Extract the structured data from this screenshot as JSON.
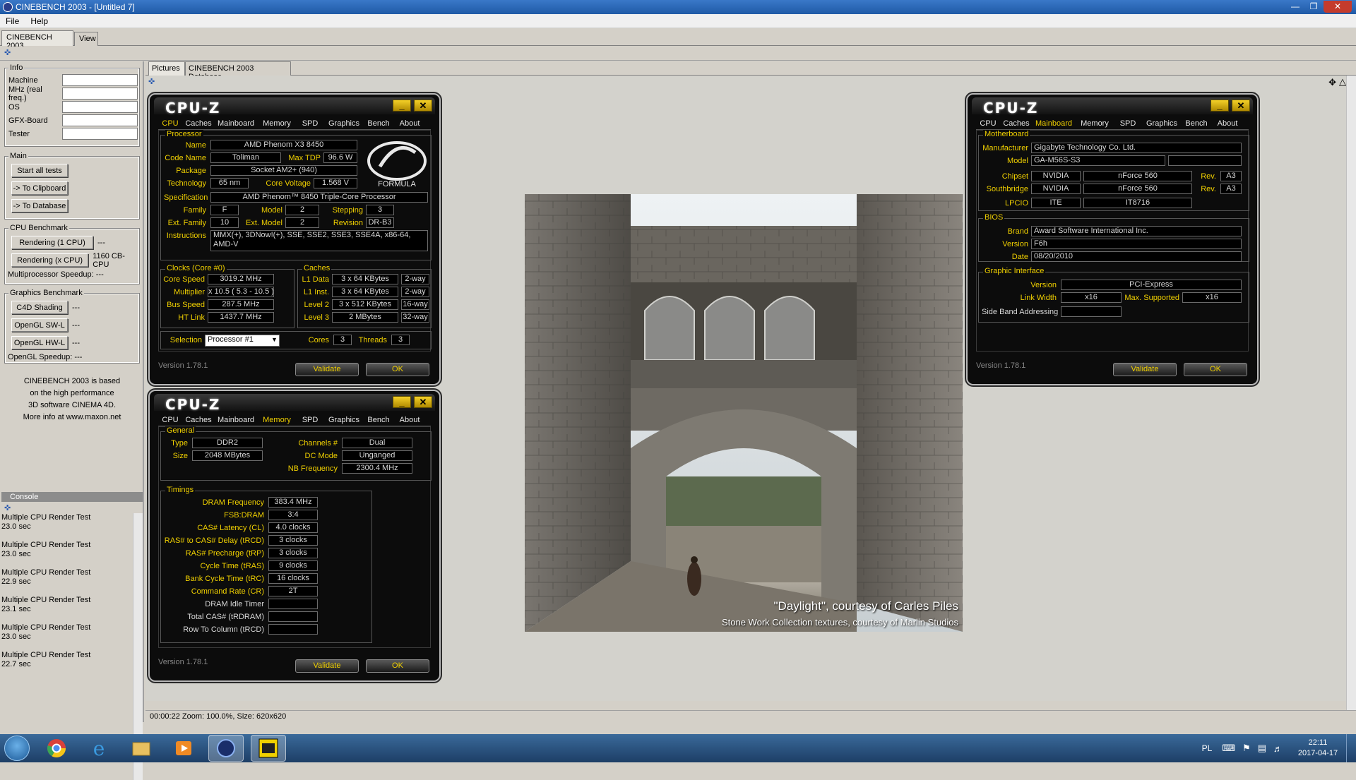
{
  "window": {
    "title": "CINEBENCH 2003 - [Untitled 7]"
  },
  "menu": [
    "File",
    "Help"
  ],
  "top_tabs": [
    "CINEBENCH 2003",
    "View"
  ],
  "info": {
    "title": "Info",
    "fields": [
      "Machine",
      "MHz (real freq.)",
      "OS",
      "GFX-Board",
      "Tester"
    ]
  },
  "main_group": {
    "title": "Main",
    "buttons": [
      "Start all tests",
      "-> To Clipboard",
      "-> To Database"
    ]
  },
  "cpu_bench": {
    "title": "CPU Benchmark",
    "btn1": "Rendering (1 CPU)",
    "val1": "---",
    "btn2": "Rendering (x CPU)",
    "val2": "1160 CB-CPU",
    "speedup": "Multiprocessor Speedup:",
    "speedup_val": "---"
  },
  "gfx_bench": {
    "title": "Graphics Benchmark",
    "btn1": "C4D Shading",
    "val1": "---",
    "btn2": "OpenGL SW-L",
    "val2": "---",
    "btn3": "OpenGL HW-L",
    "val3": "---",
    "speedup": "OpenGL Speedup:",
    "speedup_val": "---"
  },
  "about_text": [
    "CINEBENCH 2003 is based",
    "on the high performance",
    "3D software CINEMA 4D.",
    "More info at www.maxon.net"
  ],
  "console": {
    "title": "Console",
    "entries": [
      {
        "name": "Multiple CPU Render Test",
        "time": "23.0 sec"
      },
      {
        "name": "Multiple CPU Render Test",
        "time": "23.0 sec"
      },
      {
        "name": "Multiple CPU Render Test",
        "time": "22.9 sec"
      },
      {
        "name": "Multiple CPU Render Test",
        "time": "23.1 sec"
      },
      {
        "name": "Multiple CPU Render Test",
        "time": "23.0 sec"
      },
      {
        "name": "Multiple CPU Render Test",
        "time": "22.7 sec"
      }
    ]
  },
  "main_tabs": [
    "Pictures",
    "CINEBENCH 2003 Database"
  ],
  "status": "00:00:22   Zoom: 100.0%, Size: 620x620",
  "photo": {
    "caption1": "\"Daylight\", courtesy of Carles Piles",
    "caption2": "Stone Work Collection textures, courtesy of Marlin Studios"
  },
  "cpuz_common": {
    "logo": "CPU-Z",
    "tabs": [
      "CPU",
      "Caches",
      "Mainboard",
      "Memory",
      "SPD",
      "Graphics",
      "Bench",
      "About"
    ],
    "version": "Version 1.78.1",
    "validate": "Validate",
    "ok": "OK"
  },
  "cpuz_cpu": {
    "processor_legend": "Processor",
    "name_l": "Name",
    "name": "AMD Phenom X3 8450",
    "code_l": "Code Name",
    "code": "Toliman",
    "tdp_l": "Max TDP",
    "tdp": "96.6 W",
    "pkg_l": "Package",
    "pkg": "Socket AM2+ (940)",
    "tech_l": "Technology",
    "tech": "65 nm",
    "volt_l": "Core Voltage",
    "volt": "1.568 V",
    "spec_l": "Specification",
    "spec": "AMD Phenom™ 8450 Triple-Core Processor",
    "fam_l": "Family",
    "fam": "F",
    "model_l": "Model",
    "model": "2",
    "step_l": "Stepping",
    "step": "3",
    "efam_l": "Ext. Family",
    "efam": "10",
    "emodel_l": "Ext. Model",
    "emodel": "2",
    "rev_l": "Revision",
    "rev": "DR-B3",
    "instr_l": "Instructions",
    "instr": "MMX(+), 3DNow!(+), SSE, SSE2, SSE3, SSE4A, x86-64, AMD-V",
    "formula": "FORMULA",
    "clocks_legend": "Clocks (Core #0)",
    "cs_l": "Core Speed",
    "cs": "3019.2 MHz",
    "mul_l": "Multiplier",
    "mul": "x 10.5 ( 5.3 - 10.5 )",
    "bus_l": "Bus Speed",
    "bus": "287.5 MHz",
    "ht_l": "HT Link",
    "ht": "1437.7 MHz",
    "caches_legend": "Caches",
    "l1d_l": "L1 Data",
    "l1d": "3 x 64 KBytes",
    "l1d_w": "2-way",
    "l1i_l": "L1 Inst.",
    "l1i": "3 x 64 KBytes",
    "l1i_w": "2-way",
    "l2_l": "Level 2",
    "l2": "3 x 512 KBytes",
    "l2_w": "16-way",
    "l3_l": "Level 3",
    "l3": "2 MBytes",
    "l3_w": "32-way",
    "sel_l": "Selection",
    "sel": "Processor #1",
    "cores_l": "Cores",
    "cores": "3",
    "threads_l": "Threads",
    "threads": "3"
  },
  "cpuz_mem": {
    "general_legend": "General",
    "type_l": "Type",
    "type": "DDR2",
    "size_l": "Size",
    "size": "2048 MBytes",
    "ch_l": "Channels #",
    "ch": "Dual",
    "dc_l": "DC Mode",
    "dc": "Unganged",
    "nb_l": "NB Frequency",
    "nb": "2300.4 MHz",
    "timings_legend": "Timings",
    "timings": [
      {
        "label": "DRAM Frequency",
        "value": "383.4 MHz",
        "y": true
      },
      {
        "label": "FSB:DRAM",
        "value": "3:4",
        "y": true
      },
      {
        "label": "CAS# Latency (CL)",
        "value": "4.0 clocks",
        "y": true
      },
      {
        "label": "RAS# to CAS# Delay (tRCD)",
        "value": "3 clocks",
        "y": true
      },
      {
        "label": "RAS# Precharge (tRP)",
        "value": "3 clocks",
        "y": true
      },
      {
        "label": "Cycle Time (tRAS)",
        "value": "9 clocks",
        "y": true
      },
      {
        "label": "Bank Cycle Time (tRC)",
        "value": "16 clocks",
        "y": true
      },
      {
        "label": "Command Rate (CR)",
        "value": "2T",
        "y": true
      },
      {
        "label": "DRAM Idle Timer",
        "value": "",
        "y": false
      },
      {
        "label": "Total CAS# (tRDRAM)",
        "value": "",
        "y": false
      },
      {
        "label": "Row To Column (tRCD)",
        "value": "",
        "y": false
      }
    ]
  },
  "cpuz_mb": {
    "mb_legend": "Motherboard",
    "man_l": "Manufacturer",
    "man": "Gigabyte Technology Co. Ltd.",
    "model_l": "Model",
    "model": "GA-M56S-S3",
    "chip_l": "Chipset",
    "chip1": "NVIDIA",
    "chip2": "nForce 560",
    "chip_rev_l": "Rev.",
    "chip_rev": "A3",
    "sb_l": "Southbridge",
    "sb1": "NVIDIA",
    "sb2": "nForce 560",
    "sb_rev_l": "Rev.",
    "sb_rev": "A3",
    "lpc_l": "LPCIO",
    "lpc1": "ITE",
    "lpc2": "IT8716",
    "bios_legend": "BIOS",
    "brand_l": "Brand",
    "brand": "Award Software International Inc.",
    "ver_l": "Version",
    "ver": "F6h",
    "date_l": "Date",
    "date": "08/20/2010",
    "gi_legend": "Graphic Interface",
    "giv_l": "Version",
    "giv": "PCI-Express",
    "lw_l": "Link Width",
    "lw": "x16",
    "ms_l": "Max. Supported",
    "ms": "x16",
    "sba_l": "Side Band Addressing"
  },
  "tray": {
    "lang": "PL",
    "time": "22:11",
    "date": "2017-04-17"
  },
  "colors": {
    "cpuz_yellow": "#f0d000",
    "titlebar": "#1f5aa6"
  }
}
